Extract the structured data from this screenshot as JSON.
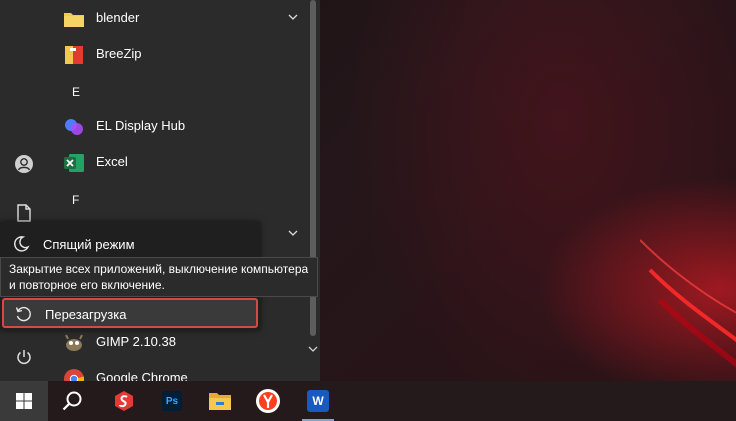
{
  "app_list": {
    "items": [
      {
        "label": "blender",
        "icon": "folder-icon"
      },
      {
        "label": "BreeZip",
        "icon": "breezip-icon"
      },
      {
        "label": "EL Display Hub",
        "icon": "el-display-hub-icon"
      },
      {
        "label": "Excel",
        "icon": "excel-icon"
      },
      {
        "label": "GIMP 2.10.38",
        "icon": "gimp-icon"
      },
      {
        "label": "Google Chrome",
        "icon": "chrome-icon"
      }
    ],
    "letters": [
      "E",
      "F"
    ]
  },
  "power_menu": {
    "sleep_label": "Спящий режим",
    "restart_label": "Перезагрузка",
    "tooltip_text": "Закрытие всех приложений, выключение компьютера и повторное его включение."
  },
  "taskbar": {
    "items": [
      "start-icon",
      "search-icon",
      "scrap-icon",
      "photoshop-icon",
      "file-explorer-icon",
      "yandex-browser-icon",
      "word-icon"
    ],
    "photoshop_text": "Ps",
    "word_text": "W"
  },
  "colors": {
    "menu_bg": "#2b2b2b",
    "highlight_border": "#d24a46",
    "excel_green": "#1d6f42",
    "word_blue": "#185abd",
    "yandex_red": "#fc3f1d"
  }
}
